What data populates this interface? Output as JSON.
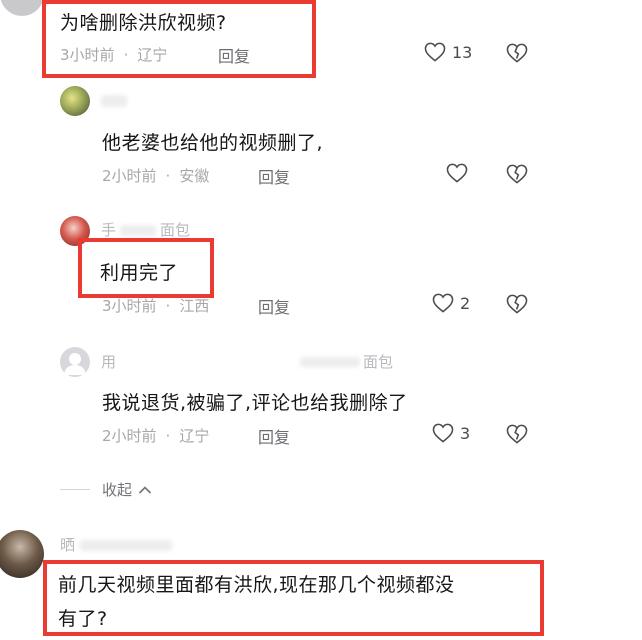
{
  "comments": [
    {
      "text": "为啥删除洪欣视频?",
      "time": "3小时前",
      "location": "辽宁",
      "reply": "回复",
      "likes": "13"
    },
    {
      "name": "",
      "text": "他老婆也给他的视频删了,",
      "time": "2小时前",
      "location": "安徽",
      "reply": "回复",
      "likes": ""
    },
    {
      "name": "手",
      "name_tail": "面包",
      "text": "利用完了",
      "time": "3小时前",
      "location": "江西",
      "reply": "回复",
      "likes": "2"
    },
    {
      "name": "用",
      "name_tail": "面包",
      "text": "我说退货,被骗了,评论也给我删除了",
      "time": "2小时前",
      "location": "辽宁",
      "reply": "回复",
      "likes": "3"
    }
  ],
  "collapse_label": "收起",
  "bottom_comment": {
    "name": "晒",
    "text_line1": "前几天视频里面都有洪欣,现在那几个视频都没",
    "text_line2": "有了?"
  },
  "colors": {
    "highlight": "#ea3b32",
    "text": "#17171a",
    "meta": "#a7a7ab"
  },
  "icons": [
    "heart-icon",
    "broken-heart-icon",
    "chevron-up-icon"
  ]
}
